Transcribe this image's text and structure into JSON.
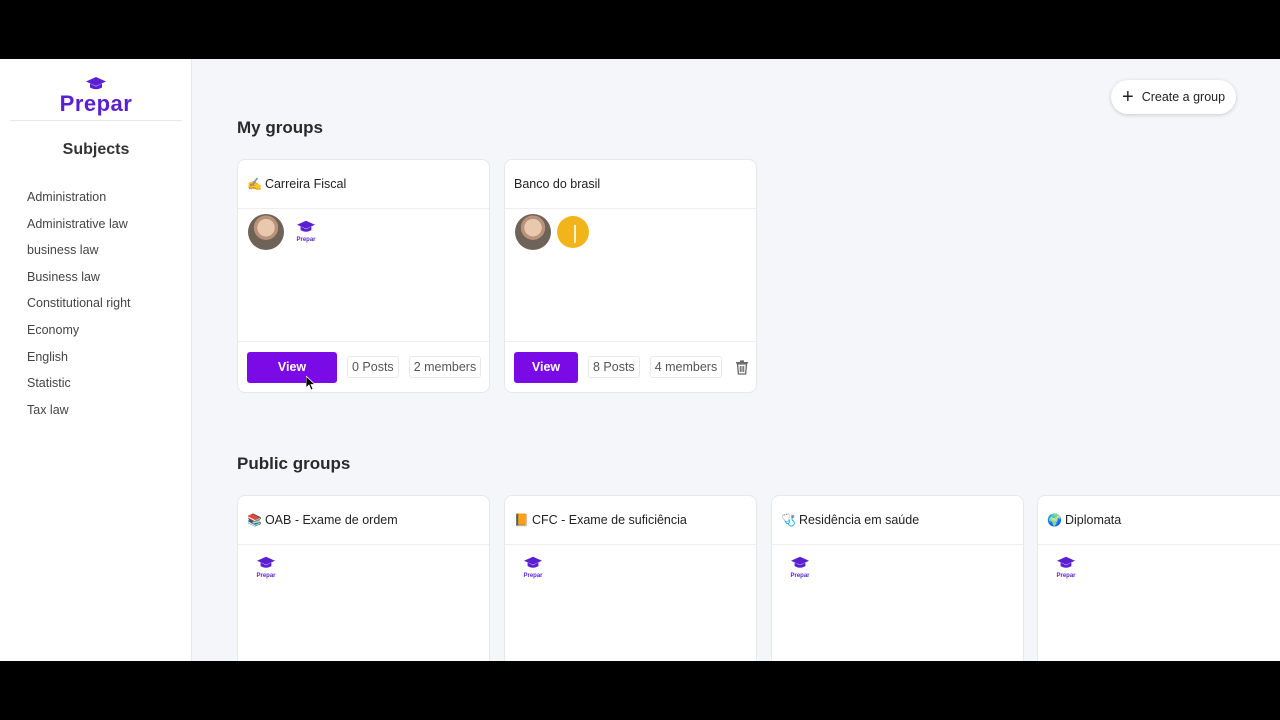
{
  "brand": {
    "name": "Prepar",
    "color": "#5a1fd1",
    "accent": "#7a0ae6"
  },
  "sidebar": {
    "title": "Subjects",
    "items": [
      {
        "label": "Administration"
      },
      {
        "label": "Administrative law"
      },
      {
        "label": "business law"
      },
      {
        "label": "Business law"
      },
      {
        "label": "Constitutional right"
      },
      {
        "label": "Economy"
      },
      {
        "label": "English"
      },
      {
        "label": "Statistic"
      },
      {
        "label": "Tax law"
      }
    ]
  },
  "header": {
    "create_label": "Create a group",
    "create_icon": "plus-icon"
  },
  "my_groups": {
    "title": "My groups",
    "cards": [
      {
        "emoji": "✍️",
        "name": "Carreira Fiscal",
        "view_label": "View",
        "posts": "0 Posts",
        "members": "2 members",
        "deletable": false
      },
      {
        "emoji": "",
        "name": "Banco do brasil",
        "view_label": "View",
        "posts": "8 Posts",
        "members": "4 members",
        "deletable": true
      }
    ]
  },
  "public_groups": {
    "title": "Public groups",
    "cards": [
      {
        "emoji": "📚",
        "name": "OAB - Exame de ordem"
      },
      {
        "emoji": "📙",
        "name": "CFC - Exame de suficiência"
      },
      {
        "emoji": "🩺",
        "name": "Residência em saúde"
      },
      {
        "emoji": "🌍",
        "name": "Diplomata"
      }
    ]
  }
}
